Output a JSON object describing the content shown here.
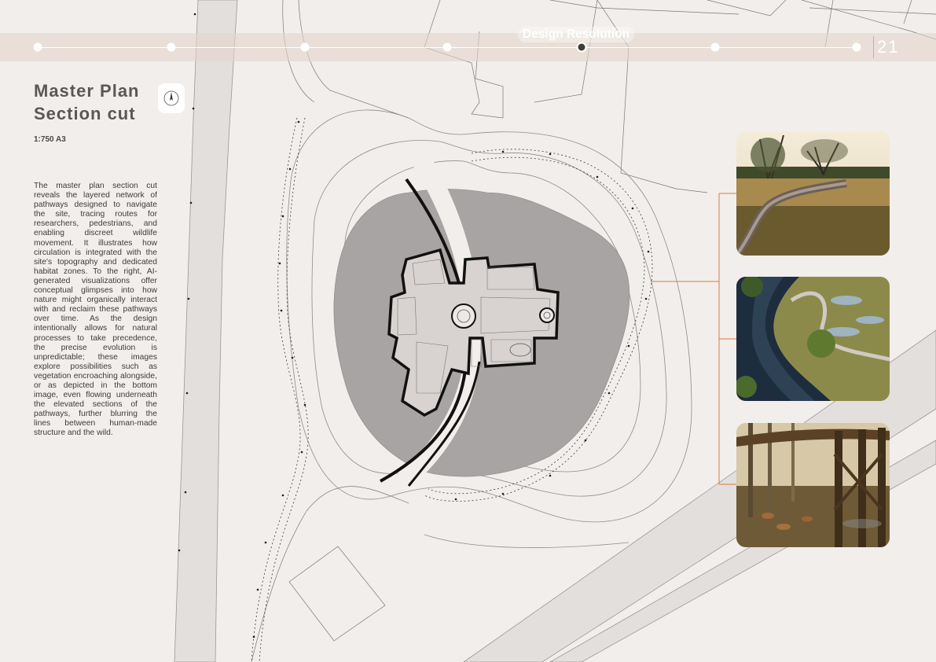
{
  "header": {
    "section_label": "Design Resolution",
    "page_number": "21",
    "timeline_steps": 7,
    "active_step": 5
  },
  "title": {
    "line1": "Master Plan",
    "line2": "Section cut"
  },
  "scale": "1:750 A3",
  "description": "The master plan section cut reveals the layered network of pathways designed to navigate the site, tracing routes for researchers, pedestrians, and enabling discreet wildlife movement. It illustrates how circulation is integrated with the site's topography and dedicated habitat zones. To the right, AI-generated visualizations offer conceptual glimpses into how nature might organically interact with and reclaim these pathways over time. As the design intentionally allows for natural processes to take precedence, the precise evolution is unpredictable; these images explore possibilities such as vegetation encroaching alongside, or as depicted in the bottom image, even flowing underneath the elevated sections of the pathways, further blurring the lines between human-made structure and the wild.",
  "images": [
    {
      "icon": "boardwalk-meadow-photo"
    },
    {
      "icon": "boardwalk-wetland-river-photo"
    },
    {
      "icon": "elevated-boardwalk-forest-deer-photo"
    }
  ],
  "colors": {
    "background": "#f2eeec",
    "accent_line": "#d97a45",
    "building_fill": "#a8a4a3",
    "text": "#5a5857"
  }
}
